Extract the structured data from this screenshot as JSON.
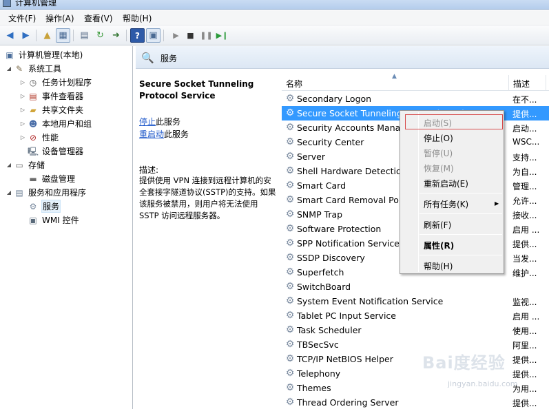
{
  "window": {
    "title": "计算机管理"
  },
  "menu": {
    "file": "文件(F)",
    "action": "操作(A)",
    "view": "查看(V)",
    "help": "帮助(H)"
  },
  "tree": {
    "root": "计算机管理(本地)",
    "system_tools": "系统工具",
    "task_scheduler": "任务计划程序",
    "event_viewer": "事件查看器",
    "shared_folders": "共享文件夹",
    "local_users": "本地用户和组",
    "performance": "性能",
    "device_manager": "设备管理器",
    "storage": "存储",
    "disk_management": "磁盘管理",
    "services_apps": "服务和应用程序",
    "services": "服务",
    "wmi": "WMI 控件"
  },
  "panel": {
    "title": "服务"
  },
  "description": {
    "service_name": "Secure Socket Tunneling Protocol Service",
    "stop_link": "停止",
    "stop_suffix": "此服务",
    "restart_link": "重启动",
    "restart_suffix": "此服务",
    "label": "描述:",
    "text": "提供使用 VPN 连接到远程计算机的安全套接字隧道协议(SSTP)的支持。如果该服务被禁用，则用户将无法使用 SSTP 访问远程服务器。"
  },
  "list": {
    "col_name": "名称",
    "col_desc": "描述",
    "rows": [
      {
        "name": "Secondary Logon",
        "desc": "在不..."
      },
      {
        "name": "Secure Socket Tunneling Protocol Service",
        "desc": "提供..."
      },
      {
        "name": "Security Accounts Manager",
        "desc": "启动..."
      },
      {
        "name": "Security Center",
        "desc": "WSC..."
      },
      {
        "name": "Server",
        "desc": "支持..."
      },
      {
        "name": "Shell Hardware Detection",
        "desc": "为自..."
      },
      {
        "name": "Smart Card",
        "desc": "管理..."
      },
      {
        "name": "Smart Card Removal Policy",
        "desc": "允许..."
      },
      {
        "name": "SNMP Trap",
        "desc": "接收..."
      },
      {
        "name": "Software Protection",
        "desc": "启用 ..."
      },
      {
        "name": "SPP Notification Service",
        "desc": "提供..."
      },
      {
        "name": "SSDP Discovery",
        "desc": "当发..."
      },
      {
        "name": "Superfetch",
        "desc": "维护..."
      },
      {
        "name": "SwitchBoard",
        "desc": ""
      },
      {
        "name": "System Event Notification Service",
        "desc": "监视..."
      },
      {
        "name": "Tablet PC Input Service",
        "desc": "启用 ..."
      },
      {
        "name": "Task Scheduler",
        "desc": "使用..."
      },
      {
        "name": "TBSecSvc",
        "desc": "阿里..."
      },
      {
        "name": "TCP/IP NetBIOS Helper",
        "desc": "提供..."
      },
      {
        "name": "Telephony",
        "desc": "提供..."
      },
      {
        "name": "Themes",
        "desc": "为用..."
      },
      {
        "name": "Thread Ordering Server",
        "desc": "提供..."
      }
    ]
  },
  "context_menu": {
    "start": "启动(S)",
    "stop": "停止(O)",
    "pause": "暂停(U)",
    "resume": "恢复(M)",
    "restart": "重新启动(E)",
    "all_tasks": "所有任务(K)",
    "refresh": "刷新(F)",
    "properties": "属性(R)",
    "help": "帮助(H)"
  },
  "watermark": {
    "brand": "Bai度经验",
    "url": "jingyan.baidu.com"
  }
}
